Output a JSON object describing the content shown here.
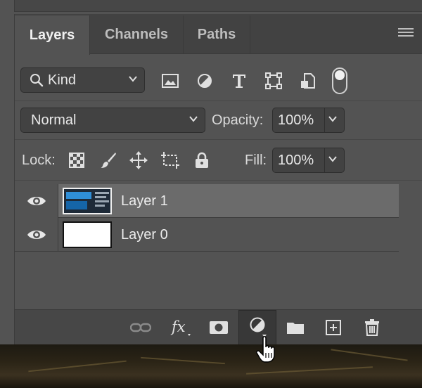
{
  "tabs": [
    {
      "label": "Layers",
      "active": true
    },
    {
      "label": "Channels",
      "active": false
    },
    {
      "label": "Paths",
      "active": false
    }
  ],
  "filter": {
    "label": "Kind",
    "icons": [
      "image-filter-icon",
      "adjustment-filter-icon",
      "type-filter-icon",
      "shape-filter-icon",
      "smart-object-filter-icon",
      "filter-toggle-icon"
    ]
  },
  "blend": {
    "mode": "Normal",
    "opacity_label": "Opacity:",
    "opacity_value": "100%"
  },
  "lock": {
    "label": "Lock:",
    "fill_label": "Fill:",
    "fill_value": "100%"
  },
  "layers": [
    {
      "name": "Layer 1",
      "visible": true,
      "selected": true
    },
    {
      "name": "Layer 0",
      "visible": true,
      "selected": false
    }
  ],
  "footer_icons": [
    "link-layers-icon",
    "fx-icon",
    "add-mask-icon",
    "adjustment-layer-icon",
    "new-group-icon",
    "new-layer-icon",
    "delete-layer-icon"
  ],
  "colors": {
    "panel": "#535353",
    "tabbar": "#424242",
    "selected_row": "#6b6b6b"
  }
}
